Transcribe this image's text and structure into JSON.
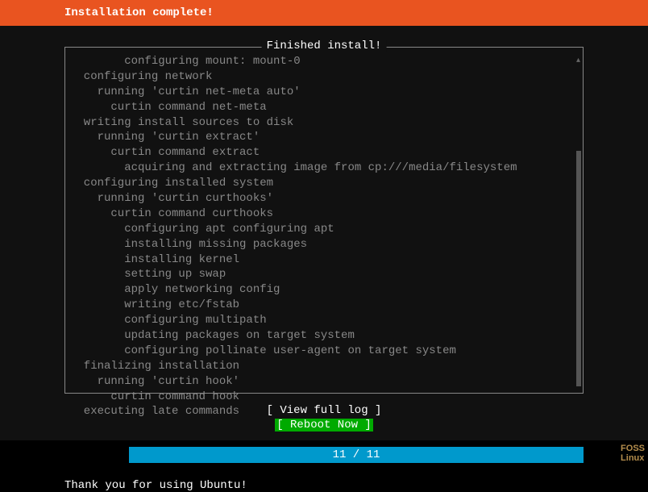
{
  "header": {
    "title": "Installation complete!"
  },
  "box": {
    "title": " Finished install! "
  },
  "log": {
    "lines": [
      "        configuring mount: mount-0",
      "  configuring network",
      "    running 'curtin net-meta auto'",
      "      curtin command net-meta",
      "  writing install sources to disk",
      "    running 'curtin extract'",
      "      curtin command extract",
      "        acquiring and extracting image from cp:///media/filesystem",
      "  configuring installed system",
      "    running 'curtin curthooks'",
      "      curtin command curthooks",
      "        configuring apt configuring apt",
      "        installing missing packages",
      "        installing kernel",
      "        setting up swap",
      "        apply networking config",
      "        writing etc/fstab",
      "        configuring multipath",
      "        updating packages on target system",
      "        configuring pollinate user-agent on target system",
      "  finalizing installation",
      "    running 'curtin hook'",
      "      curtin command hook",
      "  executing late commands"
    ]
  },
  "buttons": {
    "view_log": "[ View full log ]",
    "reboot": "[ Reboot Now    ]"
  },
  "progress": {
    "text": "11 / 11"
  },
  "footer": {
    "text": "Thank you for using Ubuntu!"
  },
  "watermark": {
    "line1": "FOSS",
    "line2": "Linux"
  }
}
